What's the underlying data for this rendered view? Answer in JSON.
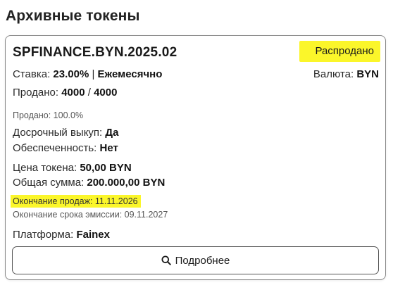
{
  "section": {
    "title": "Архивные токены"
  },
  "card": {
    "token_name": "SPFINANCE.BYN.2025.02",
    "status": "Распродано",
    "rate_label": "Ставка:",
    "rate_value": "23.00%",
    "rate_separator": "|",
    "payment_frequency": "Ежемесячно",
    "currency_label": "Валюта:",
    "currency_value": "BYN",
    "sold_label": "Продано:",
    "sold_value": "4000",
    "sold_separator": "/",
    "total_value": "4000",
    "sold_percent_text": "Продано: 100.0%",
    "early_redemption_label": "Досрочный выкуп:",
    "early_redemption_value": "Да",
    "collateral_label": "Обеспеченность:",
    "collateral_value": "Нет",
    "token_price_label": "Цена токена:",
    "token_price_value": "50,00 BYN",
    "total_amount_label": "Общая сумма:",
    "total_amount_value": "200.000,00 BYN",
    "sales_end_text": "Окончание продаж: 11.11.2026",
    "emission_end_text": "Окончание срока эмиссии: 09.11.2027",
    "platform_label": "Платформа:",
    "platform_value": "Fainex",
    "more_button_label": "Подробнее",
    "more_button_icon": "search-icon"
  },
  "colors": {
    "highlight": "#fbf62a",
    "border": "#8a8a8a"
  }
}
